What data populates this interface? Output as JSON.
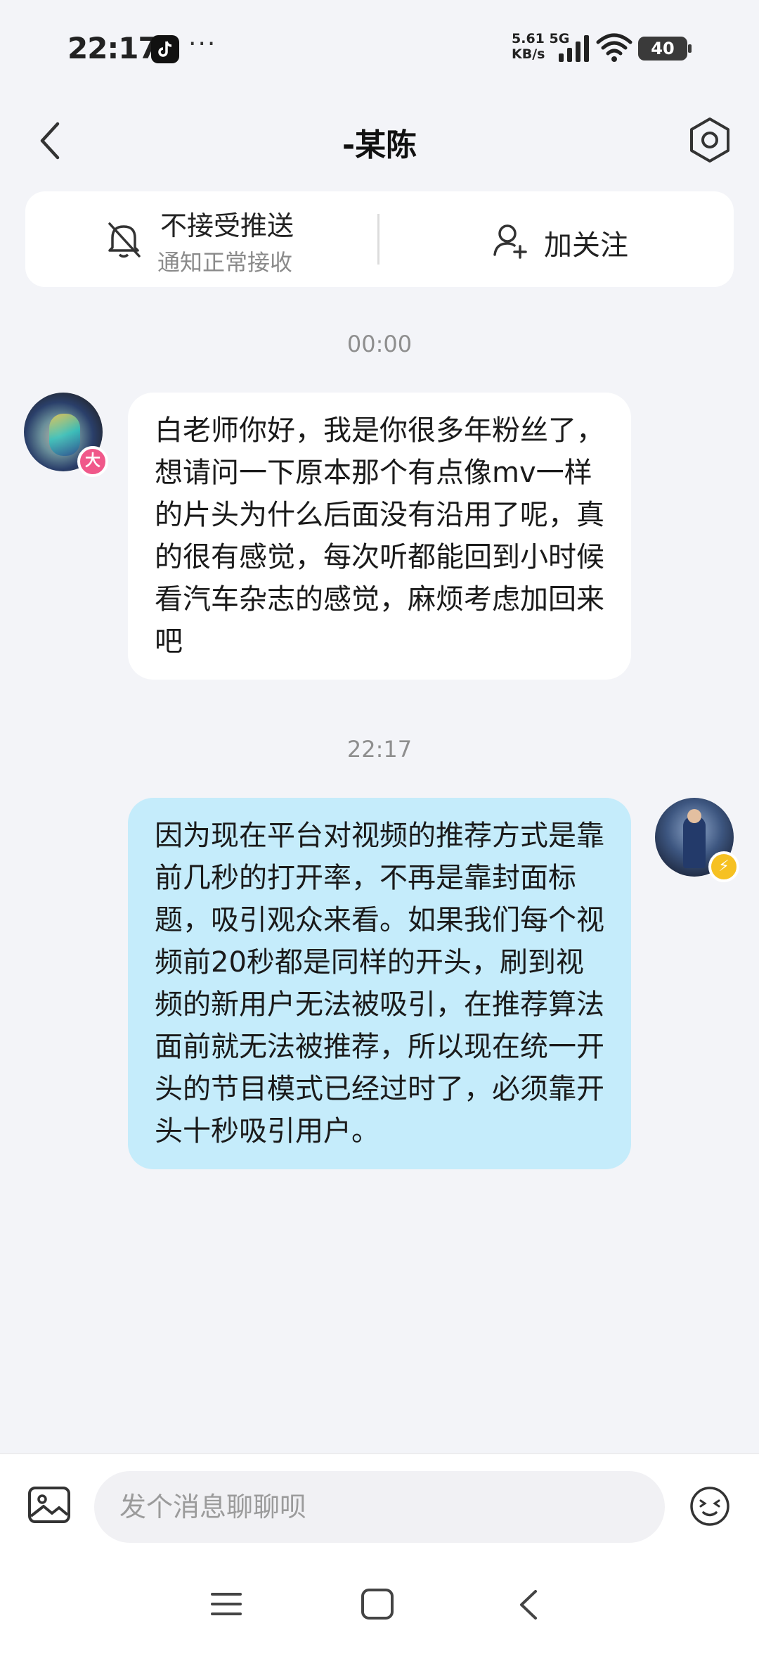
{
  "status_bar": {
    "time": "22:17",
    "more": "···",
    "net_speed_line1": "5.61",
    "net_speed_unit": "KB/s",
    "network_type": "5G",
    "battery": "40"
  },
  "header": {
    "title": "-某陈",
    "icons": [
      "chevron-left-icon",
      "settings-hexagon-icon"
    ]
  },
  "notify_card": {
    "push_title": "不接受推送",
    "push_subtitle": "通知正常接收",
    "follow_label": "加关注"
  },
  "messages": [
    {
      "timestamp": "00:00",
      "direction": "incoming",
      "badge": "大",
      "text": "白老师你好，我是你很多年粉丝了，想请问一下原本那个有点像mv一样的片头为什么后面没有沿用了呢，真的很有感觉，每次听都能回到小时候看汽车杂志的感觉，麻烦考虑加回来吧"
    },
    {
      "timestamp": "22:17",
      "direction": "outgoing",
      "badge": "⚡",
      "text": "因为现在平台对视频的推荐方式是靠前几秒的打开率，不再是靠封面标题，吸引观众来看。如果我们每个视频前20秒都是同样的开头，刷到视频的新用户无法被吸引，在推荐算法面前就无法被推荐，所以现在统一开头的节目模式已经过时了，必须靠开头十秒吸引用户。"
    }
  ],
  "input_bar": {
    "placeholder": "发个消息聊聊呗"
  },
  "colors": {
    "background": "#f3f4f8",
    "outgoing_bubble": "#c5ecfb",
    "incoming_bubble": "#ffffff",
    "badge_pink": "#f0588a",
    "badge_yellow": "#f6c122"
  }
}
